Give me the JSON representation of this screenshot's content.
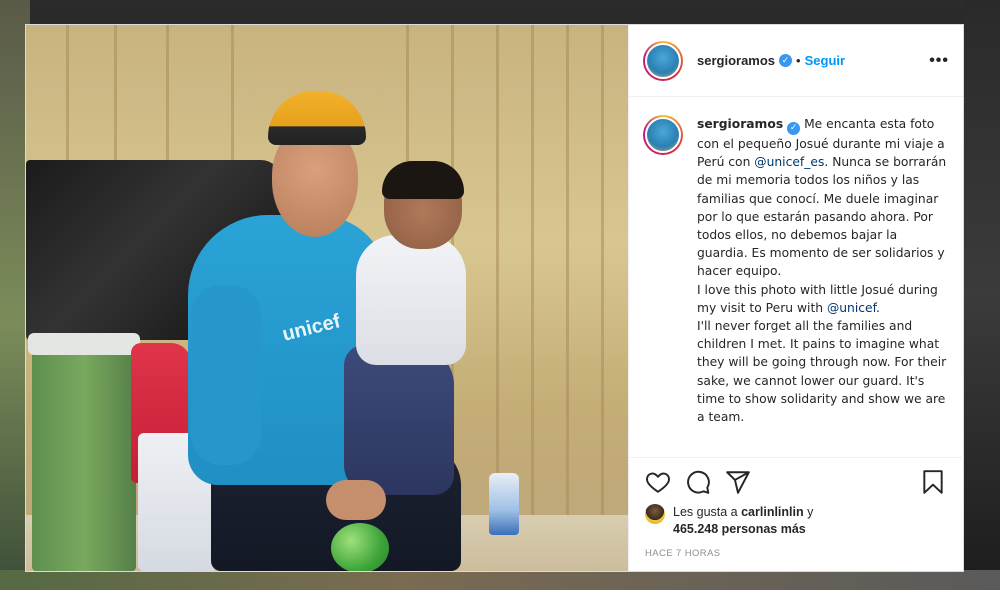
{
  "post": {
    "username": "sergioramos",
    "follow_label": "Seguir",
    "separator": "•",
    "more_label": "•••",
    "caption_text": "Me encanta esta foto con el pequeño Josué durante mi viaje a Perú con ",
    "mention_1": "@unicef_es",
    "caption_text_2": ". Nunca se borrarán de mi memoria todos los niños y las familias que conocí. Me duele imaginar por lo que estarán pasando ahora. Por todos ellos, no debemos bajar la guardia. Es momento de ser solidarios y hacer equipo.\nI love this photo with little Josué during my visit to Peru with ",
    "mention_2": "@unicef",
    "caption_text_3": ".\nI'll never forget all the families and children I met. It pains to imagine what they will be going through now. For their sake, we cannot lower our guard. It's time to show solidarity and show we are a team.",
    "photo_shirt_text": "unicef",
    "likes": {
      "prefix": "Les gusta a ",
      "user": "carlinlinlin",
      "middle": " y",
      "count": "465.248 personas más"
    },
    "time": "HACE 7 HORAS"
  },
  "icons": {
    "like": "heart-icon",
    "comment": "comment-icon",
    "share": "share-icon",
    "save": "bookmark-icon",
    "verified": "verified-badge-icon"
  },
  "colors": {
    "accent": "#0095f6",
    "verified": "#3897f0",
    "text": "#262626",
    "muted": "#8e8e8e"
  }
}
